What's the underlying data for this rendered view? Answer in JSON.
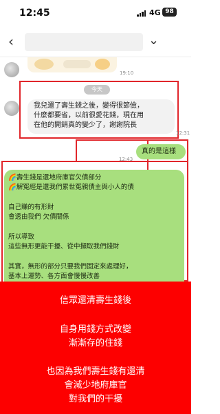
{
  "status_bar": {
    "time": "12:45",
    "network": "4G",
    "battery": "98"
  },
  "nav": {
    "back_icon": "chevron-left-icon",
    "menu_icon": "chevron-down-icon"
  },
  "chat": {
    "sticker_time": "19:10",
    "day_divider": "今天",
    "incoming_message": {
      "text": "我兒還了壽生錢之後，變得很節儉，\n什麼都要省，以前很愛花錢，現在用\n在他的開銷真的變少了，謝謝院長",
      "time": "12:31"
    },
    "reply_message": {
      "text": "真的是這樣",
      "time": "12:43"
    },
    "long_message": {
      "text": "🌈壽生錢是還地府庫官欠債部分\n🌈解冤經是還我們累世冤親債主與小人的債\n\n自己賺的有形財\n會透由我們 欠債關係\n\n所以導致\n這些無形更能干擾、從中擷取我們錢財\n\n其實，無形的部分只要我們固定來處理好，\n基本上運勢、各方面會慢慢改善"
    }
  },
  "banner": {
    "lines": [
      "信眾還清壽生錢後",
      "自身用錢方式改變",
      "漸漸存的住錢",
      "也因為我們壽生錢有還清",
      "會減少地府庫官",
      "對我們的干擾"
    ],
    "background_color": "#fd0000"
  },
  "accent_colors": {
    "highlight_border": "#e1262b",
    "outgoing_bubble": "#a8df7e"
  }
}
